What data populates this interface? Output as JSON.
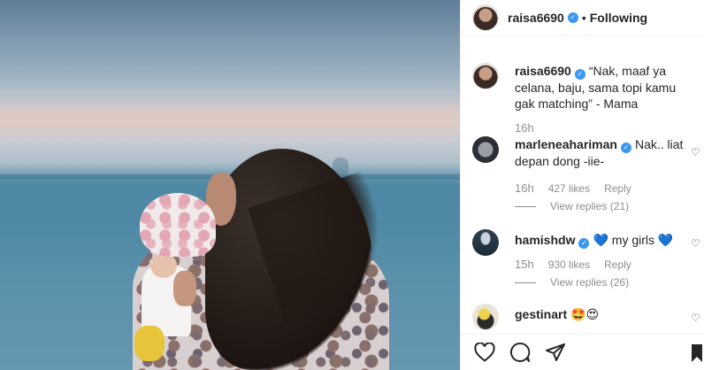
{
  "post": {
    "author": "raisa6690",
    "follow_status": "Following",
    "separator": "•"
  },
  "caption": {
    "username": "raisa6690",
    "text": "“Nak, maaf ya celana, baju, sama topi kamu gak matching” - Mama",
    "time": "16h"
  },
  "comments": [
    {
      "username": "marleneahariman",
      "verified": true,
      "text": "Nak.. liat depan dong -iie-",
      "time": "16h",
      "likes": "427 likes",
      "reply": "Reply",
      "view_replies": "View replies (21)"
    },
    {
      "username": "hamishdw",
      "verified": true,
      "text": "💙 my girls 💙",
      "time": "15h",
      "likes": "930 likes",
      "reply": "Reply",
      "view_replies": "View replies (26)"
    },
    {
      "username": "gestinart",
      "verified": false,
      "text": "🤩😍"
    }
  ],
  "icons": {
    "like": "heart-icon",
    "comment": "comment-icon",
    "share": "share-icon",
    "save": "bookmark-icon"
  },
  "colors": {
    "verified": "#3897f0",
    "muted": "#8e8e8e",
    "text": "#262626"
  }
}
